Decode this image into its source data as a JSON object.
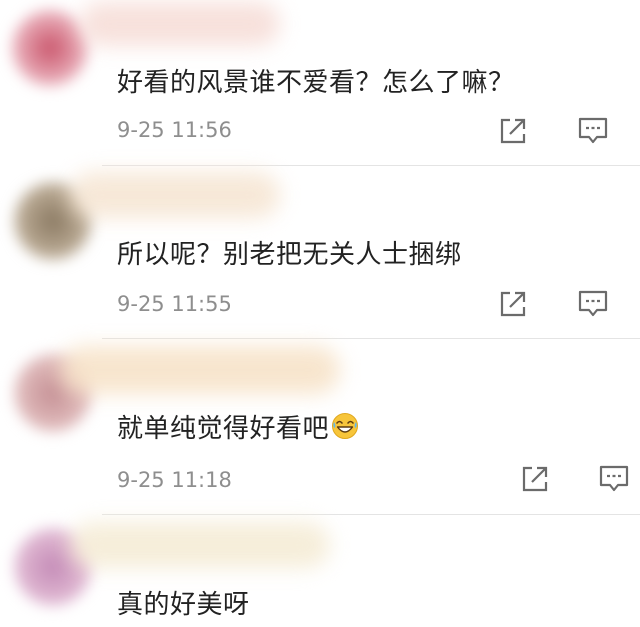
{
  "comments": [
    {
      "text": "好看的风景谁不爱看？怎么了嘛？",
      "time": "9-25 11:56",
      "avatar_color": "#d98a9a",
      "name_color": "#f6d9d5"
    },
    {
      "text": "所以呢？别老把无关人士捆绑",
      "time": "9-25 11:55",
      "avatar_color": "#a89a86",
      "name_color": "#f5e6d6"
    },
    {
      "text": "就单纯觉得好看吧",
      "emoji": "grinning-with-sweat-emoji",
      "time": "9-25 11:18",
      "avatar_color": "#d7a9ab",
      "name_color": "#f7e2cc"
    },
    {
      "text": "真的好美呀",
      "avatar_color": "#cfa0c4",
      "name_color": "#f4ecd8"
    }
  ],
  "icons": {
    "share": "share-icon",
    "reply": "reply-comment-icon"
  }
}
